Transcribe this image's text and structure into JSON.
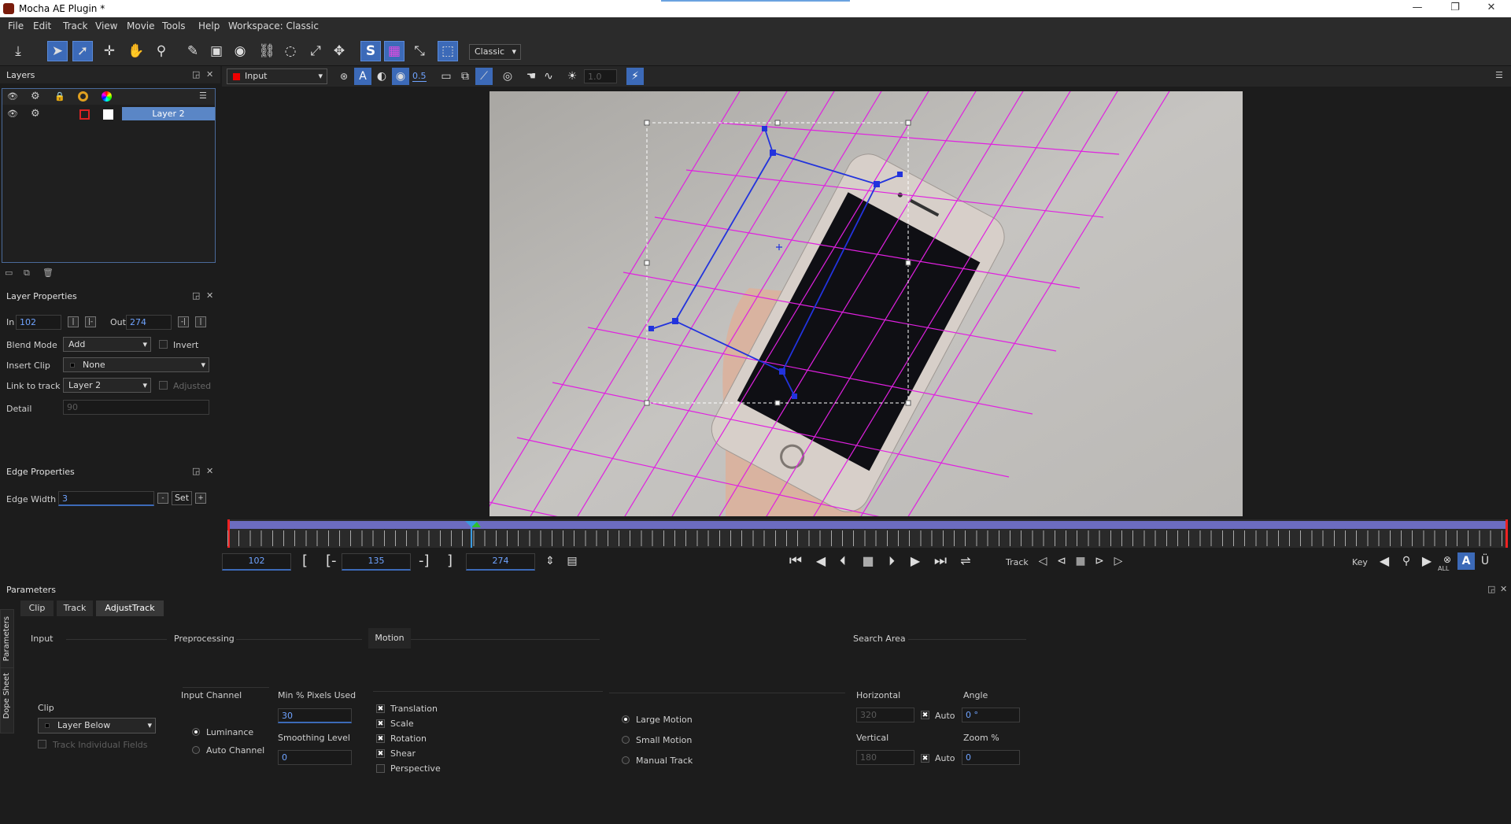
{
  "window": {
    "title": "Mocha AE Plugin *",
    "minimize": "—",
    "restore": "❐",
    "close": "✕"
  },
  "menu": {
    "file": "File",
    "edit": "Edit",
    "track": "Track",
    "view": "View",
    "movie": "Movie",
    "tools": "Tools",
    "help": "Help",
    "workspace": "Workspace: Classic"
  },
  "toolbar": {
    "workspace_select": "Classic"
  },
  "layers_panel": {
    "title": "Layers",
    "layer_name": "Layer 2"
  },
  "viewer": {
    "clip_select": "Input",
    "opacity_value": "0.5",
    "brightness_value": "1.0"
  },
  "layer_properties": {
    "title": "Layer Properties",
    "in_label": "In",
    "in_value": "102",
    "out_label": "Out",
    "out_value": "274",
    "blend_mode_label": "Blend Mode",
    "blend_mode_value": "Add",
    "invert_label": "Invert",
    "insert_clip_label": "Insert Clip",
    "insert_clip_value": "None",
    "link_to_track_label": "Link to track",
    "link_to_track_value": "Layer 2",
    "adjusted_label": "Adjusted",
    "detail_label": "Detail",
    "detail_value": "90"
  },
  "edge_properties": {
    "title": "Edge Properties",
    "edge_width_label": "Edge Width",
    "edge_width_value": "3",
    "minus": "-",
    "set": "Set",
    "plus": "+"
  },
  "timeline": {
    "in_frame": "102",
    "current_frame": "135",
    "out_frame": "274",
    "bracket_open": "[",
    "bracket_open_dash": "[-",
    "bracket_close_dash": "-]",
    "bracket_close": "]",
    "track_label": "Track",
    "key_label": "Key",
    "all_label": "ALL"
  },
  "parameters": {
    "title": "Parameters",
    "tabs": [
      "Clip",
      "Track",
      "AdjustTrack"
    ],
    "side_tabs": [
      "Parameters",
      "Dope Sheet"
    ],
    "input_section": "Input",
    "clip_label": "Clip",
    "clip_value": "Layer Below",
    "track_individual_fields": "Track Individual Fields",
    "preprocessing_section": "Preprocessing",
    "input_channel_label": "Input Channel",
    "luminance": "Luminance",
    "auto_channel": "Auto Channel",
    "min_pixels_label": "Min % Pixels Used",
    "min_pixels_value": "30",
    "smoothing_label": "Smoothing Level",
    "smoothing_value": "0",
    "motion_section": "Motion",
    "translation": "Translation",
    "scale": "Scale",
    "rotation": "Rotation",
    "shear": "Shear",
    "perspective": "Perspective",
    "large_motion": "Large Motion",
    "small_motion": "Small Motion",
    "manual_track": "Manual Track",
    "search_area_section": "Search Area",
    "horizontal_label": "Horizontal",
    "horizontal_value": "320",
    "auto_h": "Auto",
    "angle_label": "Angle",
    "angle_value": "0 °",
    "vertical_label": "Vertical",
    "vertical_value": "180",
    "auto_v": "Auto",
    "zoom_label": "Zoom %",
    "zoom_value": "0"
  },
  "colors": {
    "accent": "#3c6ab8",
    "grid": "#e020e0",
    "spline": "#2233dd",
    "layer_selected": "#5a86c6"
  }
}
